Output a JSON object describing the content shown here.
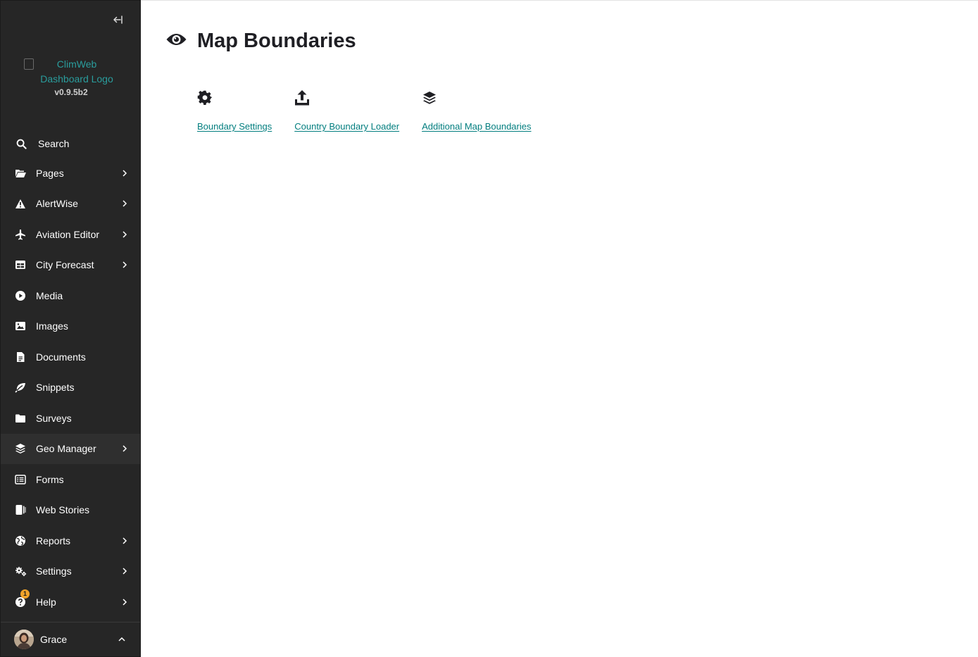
{
  "sidebar": {
    "logo_alt": "ClimWeb Dashboard Logo",
    "version": "v0.9.5b2",
    "search_label": "Search",
    "items": [
      {
        "label": "Pages",
        "icon": "folder-open-icon",
        "has_submenu": true
      },
      {
        "label": "AlertWise",
        "icon": "warning-icon",
        "has_submenu": true
      },
      {
        "label": "Aviation Editor",
        "icon": "plane-icon",
        "has_submenu": true
      },
      {
        "label": "City Forecast",
        "icon": "table-icon",
        "has_submenu": true
      },
      {
        "label": "Media",
        "icon": "play-circle-icon",
        "has_submenu": false
      },
      {
        "label": "Images",
        "icon": "image-icon",
        "has_submenu": false
      },
      {
        "label": "Documents",
        "icon": "document-icon",
        "has_submenu": false
      },
      {
        "label": "Snippets",
        "icon": "leaf-icon",
        "has_submenu": false
      },
      {
        "label": "Surveys",
        "icon": "folder-icon",
        "has_submenu": false
      },
      {
        "label": "Geo Manager",
        "icon": "layers-icon",
        "has_submenu": true
      },
      {
        "label": "Forms",
        "icon": "list-icon",
        "has_submenu": false
      },
      {
        "label": "Web Stories",
        "icon": "stories-icon",
        "has_submenu": false
      },
      {
        "label": "Reports",
        "icon": "globe-icon",
        "has_submenu": true
      },
      {
        "label": "Settings",
        "icon": "cogs-icon",
        "has_submenu": true
      },
      {
        "label": "Help",
        "icon": "help-icon",
        "has_submenu": true,
        "badge": "1"
      }
    ],
    "account": {
      "name": "Grace"
    }
  },
  "main": {
    "title": "Map Boundaries",
    "title_icon": "eye-icon",
    "links": [
      {
        "label": "Boundary Settings",
        "icon": "cog-icon"
      },
      {
        "label": "Country Boundary Loader",
        "icon": "upload-icon"
      },
      {
        "label": "Additional Map Boundaries",
        "icon": "layers-icon"
      }
    ]
  },
  "colors": {
    "sidebar_bg": "#262626",
    "link": "#007d7e",
    "badge": "#f0a32a",
    "title": "#1f1f24"
  }
}
